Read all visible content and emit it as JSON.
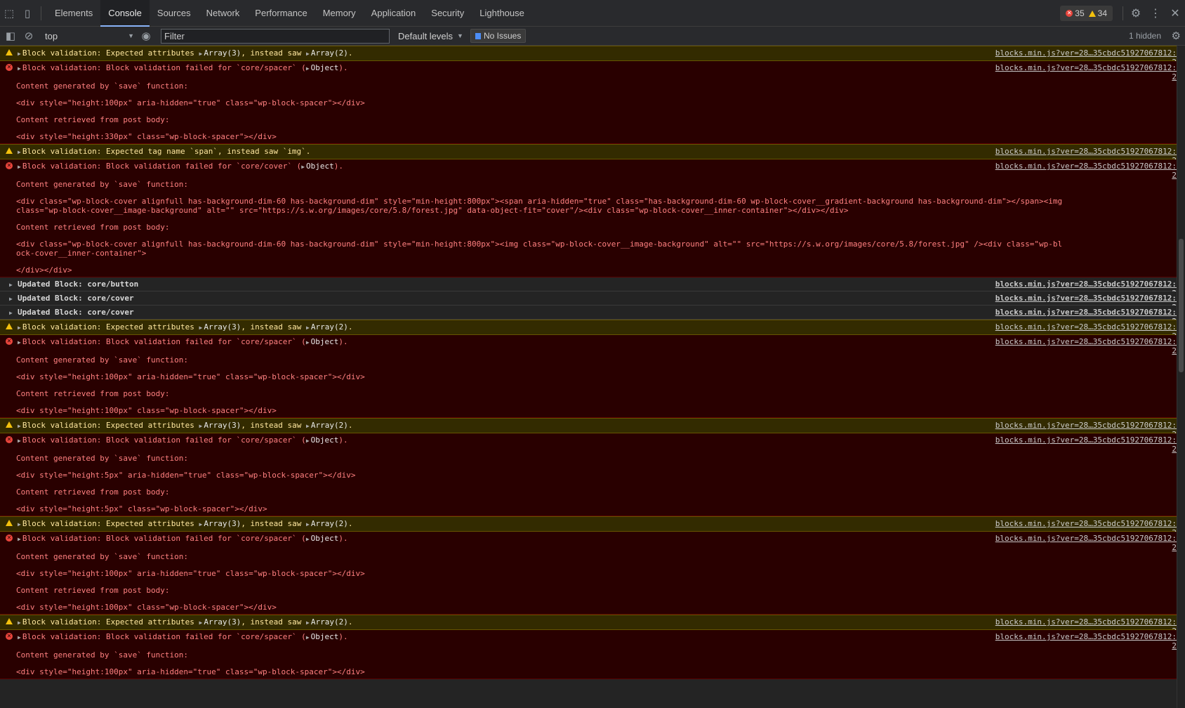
{
  "tabs": [
    "Elements",
    "Console",
    "Sources",
    "Network",
    "Performance",
    "Memory",
    "Application",
    "Security",
    "Lighthouse"
  ],
  "active_tab": "Console",
  "counts": {
    "errors": "35",
    "warnings": "34"
  },
  "toolbar": {
    "context": "top",
    "filter_placeholder": "Filter",
    "levels": "Default levels",
    "issues": "No Issues",
    "hidden": "1 hidden"
  },
  "source_link": "blocks.min.js?ver=28…35cbdc51927067812:2",
  "messages": [
    {
      "kind": "warn",
      "head": [
        "Block validation: Expected attributes ",
        "Array(3)",
        ", instead saw ",
        "Array(2)",
        "."
      ]
    },
    {
      "kind": "error",
      "head": [
        "Block validation: Block validation failed for `core/spacer` (",
        "Object",
        ")."
      ],
      "body": [
        "Content generated by `save` function:",
        "",
        "<div style=\"height:100px\" aria-hidden=\"true\" class=\"wp-block-spacer\"></div>",
        "",
        "Content retrieved from post body:",
        "",
        "<div style=\"height:330px\" class=\"wp-block-spacer\"></div>"
      ]
    },
    {
      "kind": "warn",
      "head": [
        "Block validation: Expected tag name `span`, instead saw `img`."
      ]
    },
    {
      "kind": "error",
      "head": [
        "Block validation: Block validation failed for `core/cover` (",
        "Object",
        ")."
      ],
      "body": [
        "Content generated by `save` function:",
        "",
        "<div class=\"wp-block-cover alignfull has-background-dim-60 has-background-dim\" style=\"min-height:800px\"><span aria-hidden=\"true\" class=\"has-background-dim-60 wp-block-cover__gradient-background has-background-dim\"></span><img class=\"wp-block-cover__image-background\" alt=\"\" src=\"https://s.w.org/images/core/5.8/forest.jpg\" data-object-fit=\"cover\"/><div class=\"wp-block-cover__inner-container\"></div></div>",
        "",
        "Content retrieved from post body:",
        "",
        "<div class=\"wp-block-cover alignfull has-background-dim-60 has-background-dim\" style=\"min-height:800px\"><img class=\"wp-block-cover__image-background\" alt=\"\" src=\"https://s.w.org/images/core/5.8/forest.jpg\" /><div class=\"wp-block-cover__inner-container\">",
        "",
        "</div></div>"
      ]
    },
    {
      "kind": "info",
      "head": [
        "Updated Block: core/button"
      ]
    },
    {
      "kind": "info",
      "head": [
        "Updated Block: core/cover"
      ]
    },
    {
      "kind": "info",
      "head": [
        "Updated Block: core/cover"
      ]
    },
    {
      "kind": "warn",
      "head": [
        "Block validation: Expected attributes ",
        "Array(3)",
        ", instead saw ",
        "Array(2)",
        "."
      ]
    },
    {
      "kind": "error",
      "head": [
        "Block validation: Block validation failed for `core/spacer` (",
        "Object",
        ")."
      ],
      "body": [
        "Content generated by `save` function:",
        "",
        "<div style=\"height:100px\" aria-hidden=\"true\" class=\"wp-block-spacer\"></div>",
        "",
        "Content retrieved from post body:",
        "",
        "<div style=\"height:100px\" class=\"wp-block-spacer\"></div>"
      ]
    },
    {
      "kind": "warn",
      "head": [
        "Block validation: Expected attributes ",
        "Array(3)",
        ", instead saw ",
        "Array(2)",
        "."
      ]
    },
    {
      "kind": "error",
      "head": [
        "Block validation: Block validation failed for `core/spacer` (",
        "Object",
        ")."
      ],
      "body": [
        "Content generated by `save` function:",
        "",
        "<div style=\"height:5px\" aria-hidden=\"true\" class=\"wp-block-spacer\"></div>",
        "",
        "Content retrieved from post body:",
        "",
        "<div style=\"height:5px\" class=\"wp-block-spacer\"></div>"
      ]
    },
    {
      "kind": "warn",
      "head": [
        "Block validation: Expected attributes ",
        "Array(3)",
        ", instead saw ",
        "Array(2)",
        "."
      ]
    },
    {
      "kind": "error",
      "head": [
        "Block validation: Block validation failed for `core/spacer` (",
        "Object",
        ")."
      ],
      "body": [
        "Content generated by `save` function:",
        "",
        "<div style=\"height:100px\" aria-hidden=\"true\" class=\"wp-block-spacer\"></div>",
        "",
        "Content retrieved from post body:",
        "",
        "<div style=\"height:100px\" class=\"wp-block-spacer\"></div>"
      ]
    },
    {
      "kind": "warn",
      "head": [
        "Block validation: Expected attributes ",
        "Array(3)",
        ", instead saw ",
        "Array(2)",
        "."
      ]
    },
    {
      "kind": "error",
      "head": [
        "Block validation: Block validation failed for `core/spacer` (",
        "Object",
        ")."
      ],
      "body": [
        "Content generated by `save` function:",
        "",
        "<div style=\"height:100px\" aria-hidden=\"true\" class=\"wp-block-spacer\"></div>"
      ]
    }
  ]
}
